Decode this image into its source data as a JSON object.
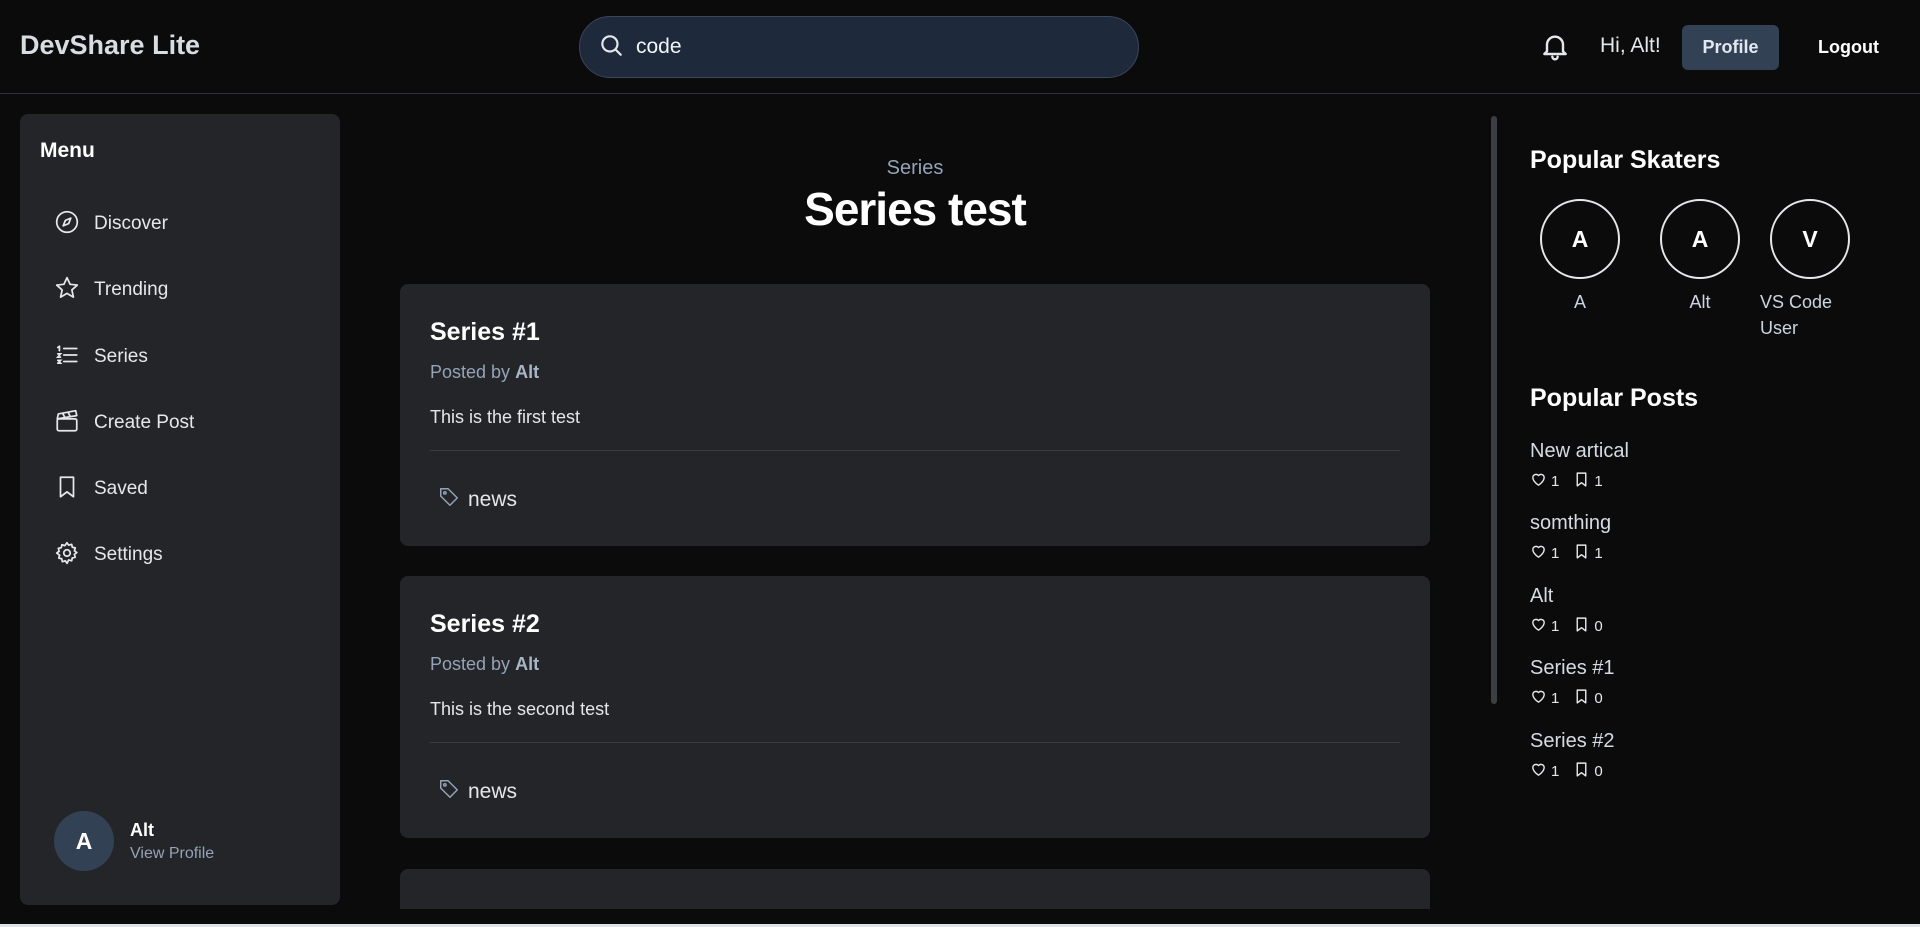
{
  "header": {
    "brand": "DevShare Lite",
    "search": {
      "value": "code",
      "placeholder": ""
    },
    "greeting": "Hi, Alt!",
    "profile_label": "Profile",
    "logout_label": "Logout"
  },
  "sidebar": {
    "title": "Menu",
    "items": [
      {
        "label": "Discover",
        "icon": "compass-icon"
      },
      {
        "label": "Trending",
        "icon": "star-icon"
      },
      {
        "label": "Series",
        "icon": "list-icon"
      },
      {
        "label": "Create Post",
        "icon": "clapperboard-icon"
      },
      {
        "label": "Saved",
        "icon": "bookmark-icon"
      },
      {
        "label": "Settings",
        "icon": "gear-icon"
      }
    ],
    "user": {
      "initial": "A",
      "name": "Alt",
      "link": "View Profile"
    }
  },
  "main": {
    "subtitle": "Series",
    "title": "Series test",
    "posts": [
      {
        "title": "Series #1",
        "posted_by_label": "Posted by",
        "author": "Alt",
        "body": "This is the first test",
        "tag": "news"
      },
      {
        "title": "Series #2",
        "posted_by_label": "Posted by",
        "author": "Alt",
        "body": "This is the second test",
        "tag": "news"
      }
    ]
  },
  "right": {
    "skaters_title": "Popular Skaters",
    "skaters": [
      {
        "initial": "A",
        "name": "A"
      },
      {
        "initial": "A",
        "name": "Alt"
      },
      {
        "initial": "V",
        "name": "VS Code User"
      }
    ],
    "posts_title": "Popular Posts",
    "popular_posts": [
      {
        "title": "New artical",
        "likes": "1",
        "saves": "1"
      },
      {
        "title": "somthing",
        "likes": "1",
        "saves": "1"
      },
      {
        "title": "Alt",
        "likes": "1",
        "saves": "0"
      },
      {
        "title": "Series #1",
        "likes": "1",
        "saves": "0"
      },
      {
        "title": "Series #2",
        "likes": "1",
        "saves": "0"
      }
    ]
  },
  "colors": {
    "background": "#0b0b0c",
    "panel": "#242528",
    "accent": "#334155",
    "muted_text": "#94a3b8"
  }
}
